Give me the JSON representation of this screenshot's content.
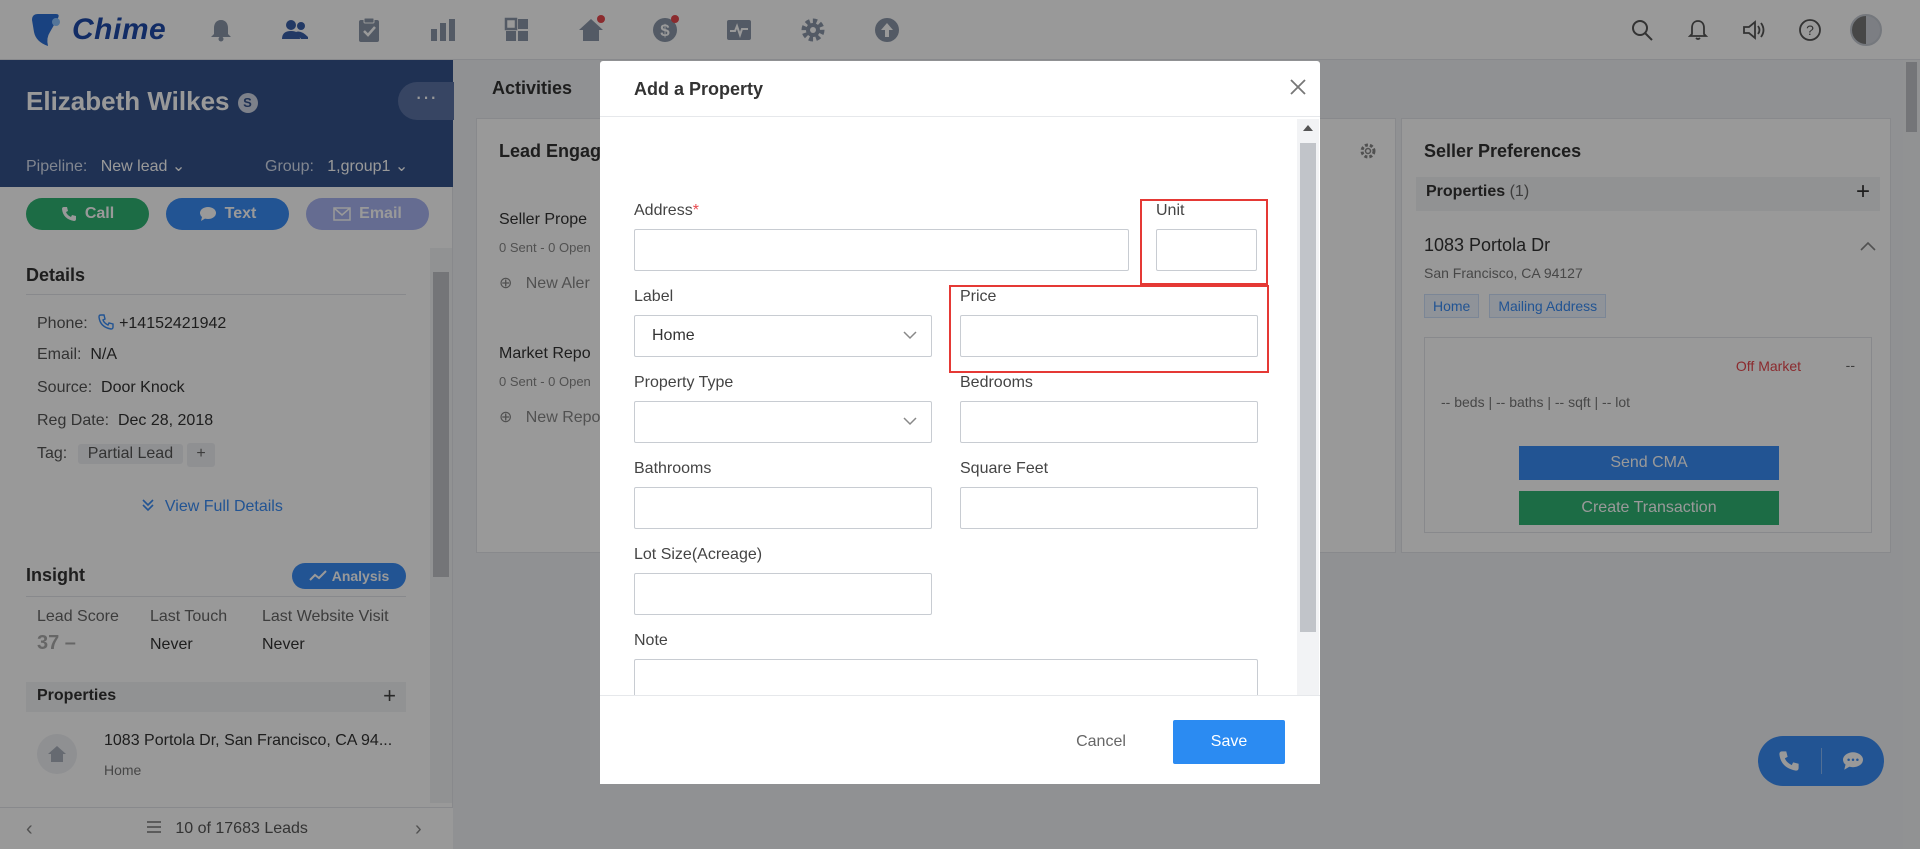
{
  "app": {
    "name": "Chime"
  },
  "topnav": {
    "icons": [
      "bell-dollar-icon",
      "contacts-icon",
      "tasks-icon",
      "bar-chart-icon",
      "dashboard-icon",
      "home-listing-icon",
      "dollar-icon",
      "pulse-icon",
      "gear-icon",
      "upload-icon"
    ],
    "right_icons": [
      "search-icon",
      "notification-bell-icon",
      "speaker-icon",
      "help-icon",
      "user-avatar"
    ]
  },
  "lead": {
    "name": "Elizabeth Wilkes",
    "badge": "S",
    "pipeline_label": "Pipeline:",
    "pipeline_value": "New lead",
    "group_label": "Group:",
    "group_value": "1,group1",
    "actions": {
      "call": "Call",
      "text": "Text",
      "email": "Email"
    },
    "details_title": "Details",
    "phone_label": "Phone:",
    "phone": "+14152421942",
    "email_label": "Email:",
    "email": "N/A",
    "source_label": "Source:",
    "source": "Door Knock",
    "regdate_label": "Reg Date:",
    "regdate": "Dec 28, 2018",
    "tag_label": "Tag:",
    "tag": "Partial Lead",
    "tag_add": "+",
    "view_full": "View Full Details",
    "insight_title": "Insight",
    "analysis": "Analysis",
    "lead_score_label": "Lead Score",
    "lead_score": "37 –",
    "last_touch_label": "Last Touch",
    "last_touch": "Never",
    "last_visit_label": "Last Website Visit",
    "last_visit": "Never",
    "properties_title": "Properties",
    "properties_add": "+",
    "property_address": "1083 Portola Dr, San Francisco, CA 94...",
    "property_label": "Home",
    "pager": "10 of 17683 Leads"
  },
  "center": {
    "activities": "Activities",
    "engagement_title": "Lead Engag",
    "seller_prop": "Seller Prope",
    "seller_prop_stats": "0 Sent - 0 Open",
    "new_alert": "New Aler",
    "market_report": "Market Repo",
    "market_stats": "0 Sent - 0 Open",
    "new_report": "New Repo"
  },
  "seller": {
    "title": "Seller Preferences",
    "properties_label": "Properties",
    "properties_count": "(1)",
    "add": "+",
    "address": "1083 Portola Dr",
    "city": "San Francisco, CA 94127",
    "chip_home": "Home",
    "chip_mailing": "Mailing Address",
    "status": "Off Market",
    "price": "--",
    "stats": "-- beds  |  -- baths  |  -- sqft  |  -- lot",
    "send_cma": "Send CMA",
    "create_transaction": "Create Transaction"
  },
  "modal": {
    "title": "Add a Property",
    "address_label": "Address",
    "required_mark": "*",
    "address_value": "",
    "unit_label": "Unit",
    "unit_value": "",
    "label_label": "Label",
    "label_value": "Home",
    "price_label": "Price",
    "price_value": "",
    "property_type_label": "Property Type",
    "property_type_value": "",
    "bedrooms_label": "Bedrooms",
    "bathrooms_label": "Bathrooms",
    "square_feet_label": "Square Feet",
    "lot_size_label": "Lot Size(Acreage)",
    "note_label": "Note",
    "cancel": "Cancel",
    "save": "Save"
  },
  "colors": {
    "brand": "#1e4aa8",
    "primary": "#2b8bf2",
    "success": "#2fb574",
    "danger": "#e8484e",
    "highlight": "#e53935"
  }
}
